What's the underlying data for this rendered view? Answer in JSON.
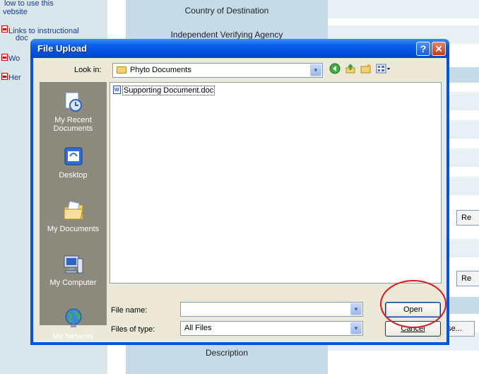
{
  "background": {
    "sidebar_links": [
      "low to use this",
      "vebsite",
      "Links to instructional",
      "doc",
      "Wo",
      "Her"
    ],
    "labels": {
      "country": "Country of Destination",
      "verifying": "Independent Verifying Agency",
      "description": "Description"
    },
    "buttons": {
      "re1": "Re",
      "re2": "Re",
      "browse": "se..."
    }
  },
  "dialog": {
    "title": "File Upload",
    "help_symbol": "?",
    "close_symbol": "✕",
    "look_in_label": "Look in:",
    "look_in_value": "Phyto Documents",
    "places": [
      {
        "label": "My Recent Documents",
        "icon": "recent-documents-icon"
      },
      {
        "label": "Desktop",
        "icon": "desktop-icon"
      },
      {
        "label": "My Documents",
        "icon": "my-documents-icon"
      },
      {
        "label": "My Computer",
        "icon": "my-computer-icon"
      },
      {
        "label": "My Network",
        "icon": "my-network-icon"
      }
    ],
    "files": [
      {
        "name": "Supporting Document.doc",
        "icon": "word-document-icon"
      }
    ],
    "file_name_label": "File name:",
    "file_name_value": "",
    "file_type_label": "Files of type:",
    "file_type_value": "All Files",
    "open_label": "Open",
    "cancel_label": "Cancel"
  },
  "colors": {
    "titlebar": "#0054e3",
    "dialog_face": "#ece9d8",
    "places_bar": "#8c8a7d",
    "highlight": "#e0141a"
  }
}
